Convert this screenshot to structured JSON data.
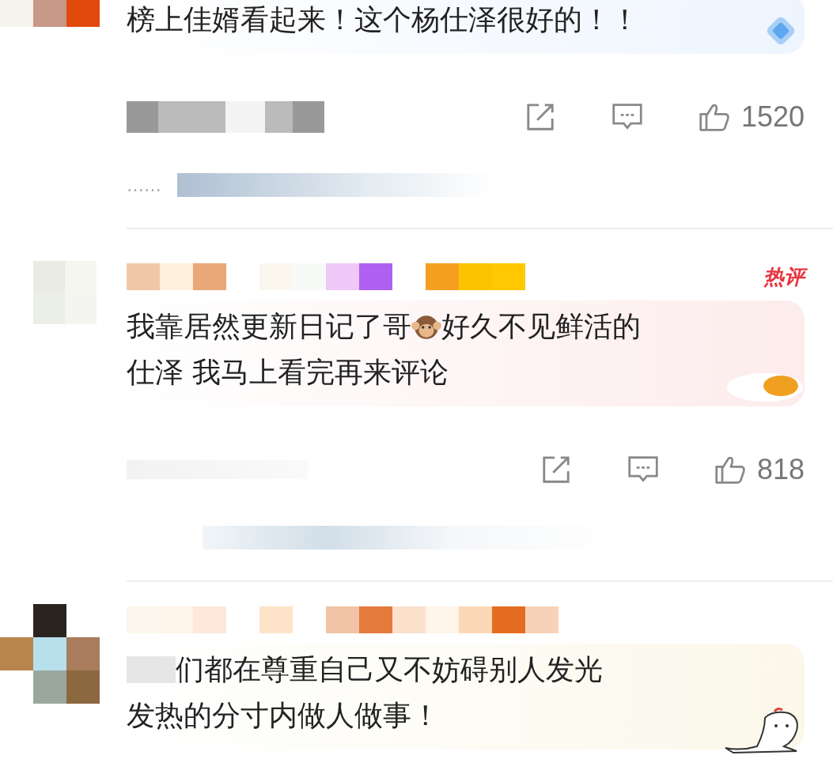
{
  "comments": [
    {
      "kind": "blue",
      "lines": [
        [
          {
            "kind": "text",
            "text": "榜上佳婿看起来！这个杨仕泽很好的！！"
          }
        ]
      ],
      "likes": "1520",
      "reply_prefix": "……"
    },
    {
      "kind": "pink",
      "badge": "热评",
      "lines": [
        [
          {
            "kind": "text",
            "text": "我靠居然更新日记了哥"
          },
          {
            "kind": "emoji"
          },
          {
            "kind": "text",
            "text": "好久不见鲜活的"
          }
        ],
        [
          {
            "kind": "text",
            "text": "仕泽 我马上看完再来评论"
          }
        ]
      ],
      "likes": "818"
    },
    {
      "kind": "cream",
      "lines": [
        [
          {
            "kind": "hidden"
          },
          {
            "kind": "text",
            "text": "们都在尊重自己又不妨碍别人发光"
          }
        ],
        [
          {
            "kind": "text",
            "text": "发热的分寸内做人做事！"
          }
        ]
      ]
    }
  ]
}
